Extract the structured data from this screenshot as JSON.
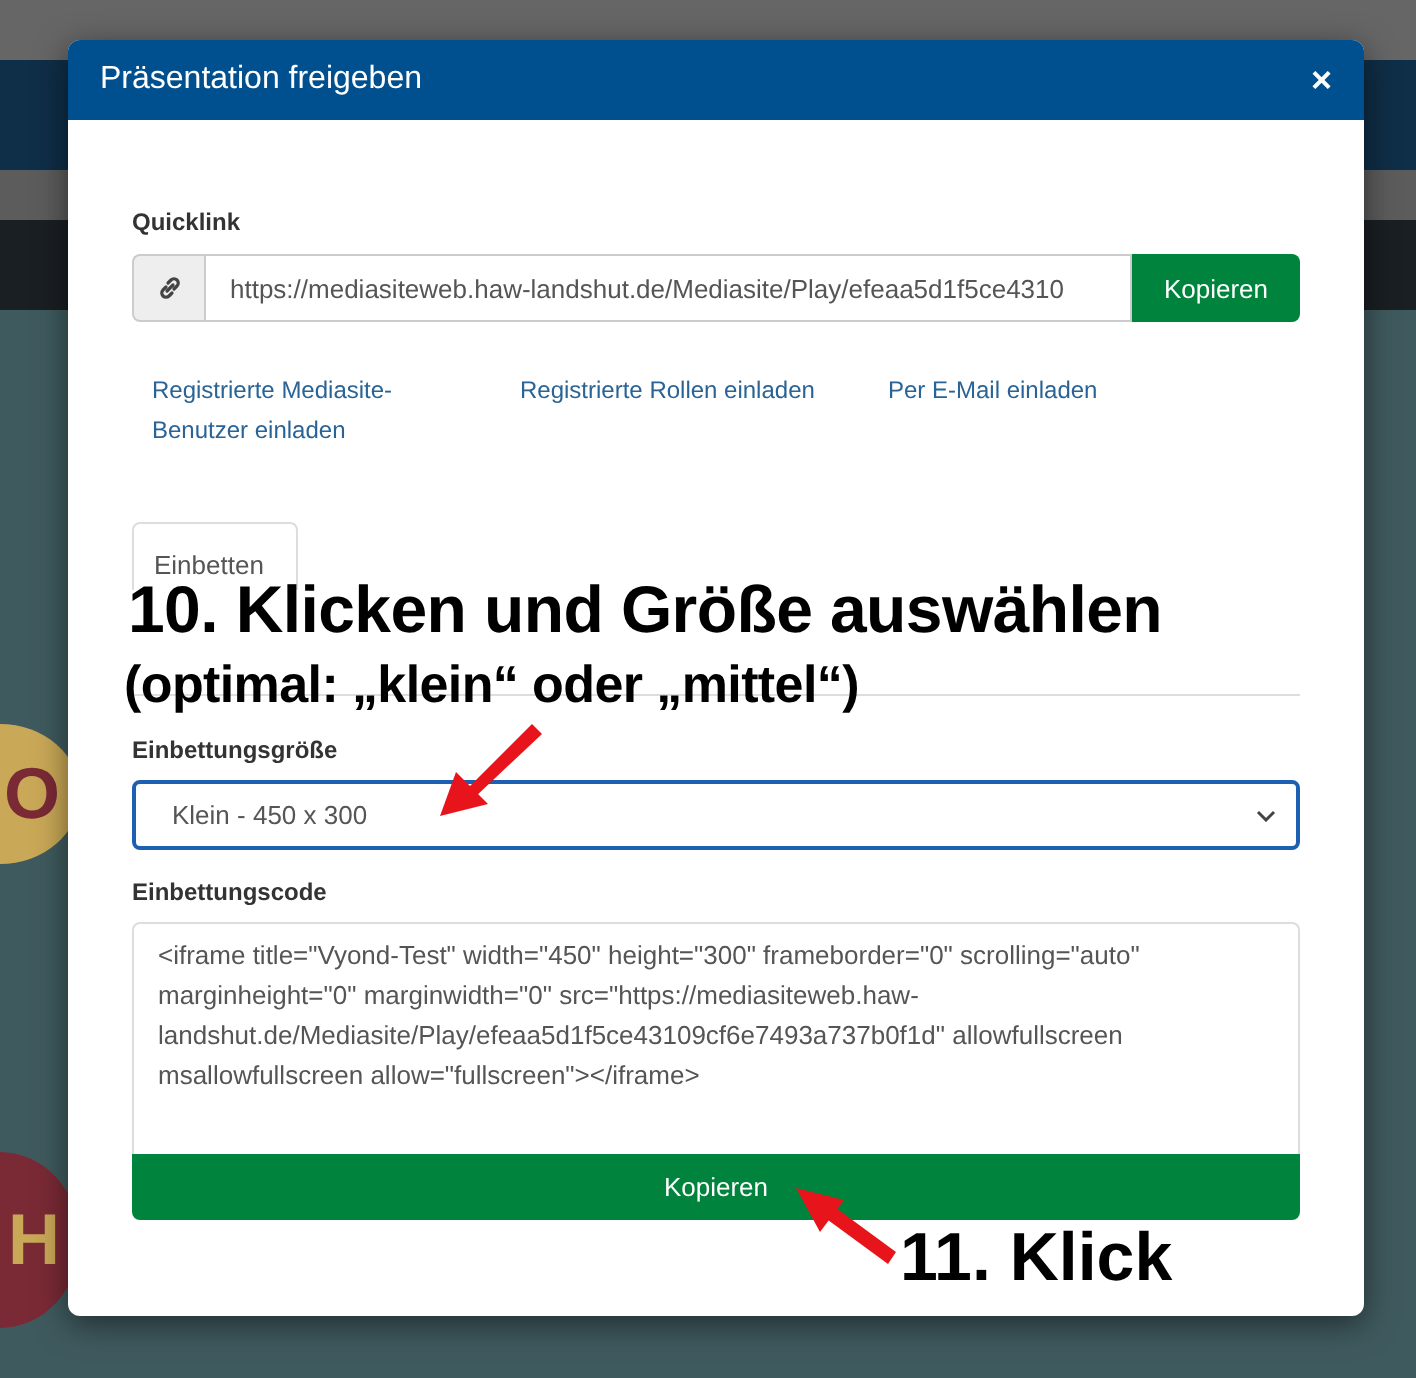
{
  "background": {
    "fragments": [
      "O",
      "H"
    ]
  },
  "dialog": {
    "title": "Präsentation freigeben",
    "close": "×",
    "quicklink": {
      "label": "Quicklink",
      "value": "https://mediasiteweb.haw-landshut.de/Mediasite/Play/efeaa5d1f5ce4310",
      "button": "Kopieren"
    },
    "invite_links": [
      "Registrierte Mediasite-Benutzer einladen",
      "Registrierte Rollen einladen",
      "Per E-Mail einladen"
    ],
    "tabs": [
      {
        "label": "Einbetten",
        "selected": true
      }
    ],
    "embed_size": {
      "label": "Einbettungsgröße",
      "value": "Klein - 450 x 300"
    },
    "embed_code": {
      "label": "Einbettungscode",
      "value": "<iframe title=\"Vyond-Test\" width=\"450\" height=\"300\" frameborder=\"0\" scrolling=\"auto\" marginheight=\"0\" marginwidth=\"0\" src=\"https://mediasiteweb.haw-landshut.de/Mediasite/Play/efeaa5d1f5ce43109cf6e7493a737b0f1d\" allowfullscreen msallowfullscreen allow=\"fullscreen\"></iframe>",
      "button": "Kopieren"
    }
  },
  "annotations": [
    {
      "kind": "title",
      "text": "10. Klicken und Größe auswählen"
    },
    {
      "kind": "subtitle",
      "text": "(optimal: „klein“ oder „mittel“)"
    },
    {
      "kind": "step",
      "text": "11. Klick"
    }
  ]
}
